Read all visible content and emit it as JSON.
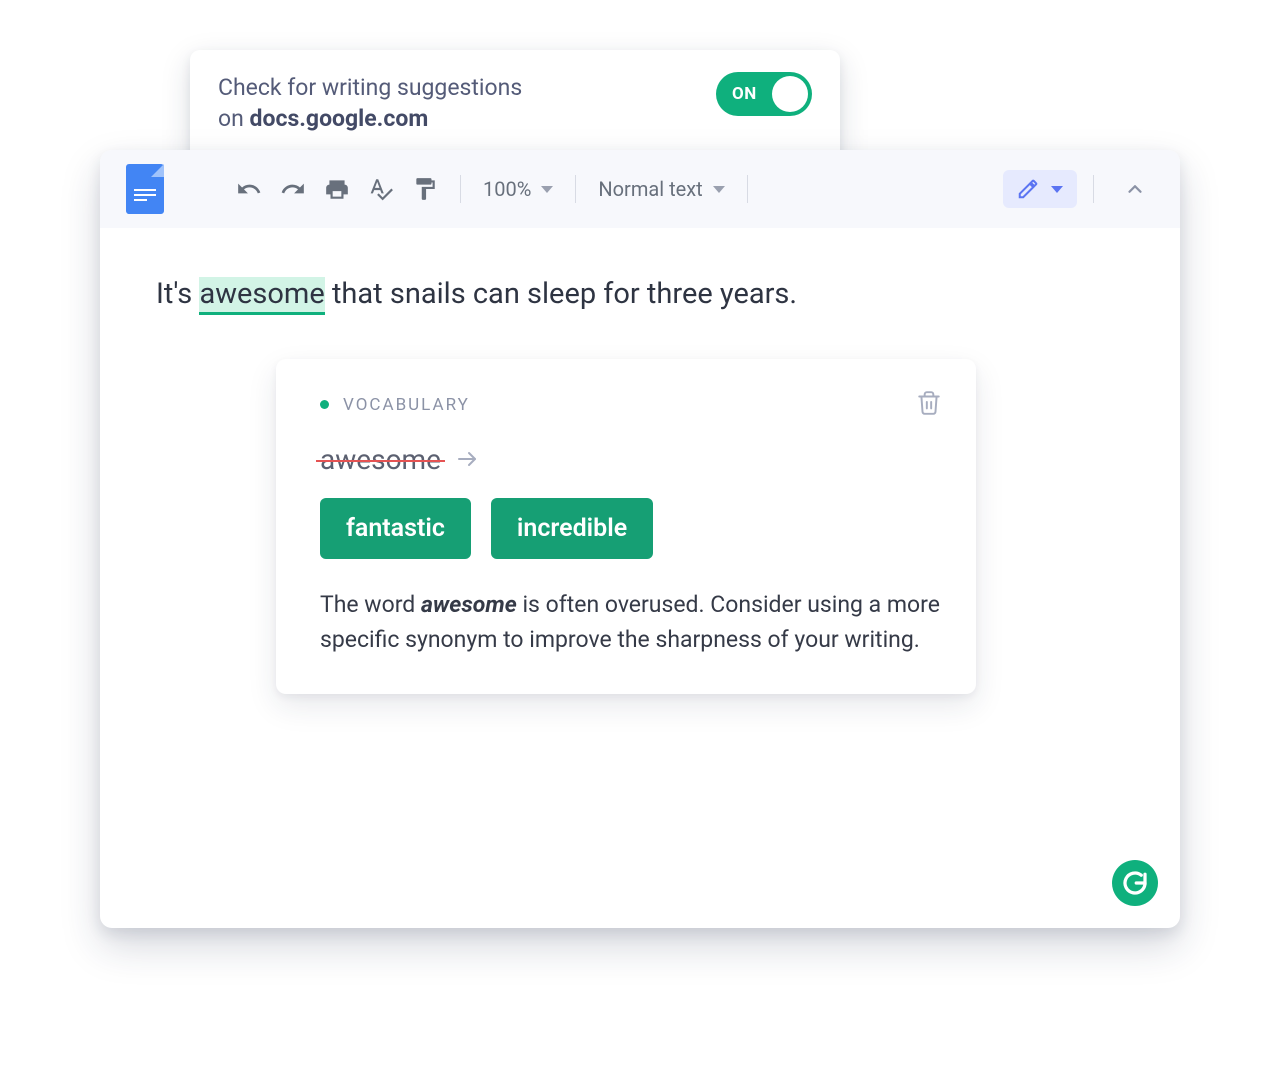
{
  "header": {
    "line1": "Check for writing suggestions",
    "line2_prefix": "on ",
    "domain": "docs.google.com",
    "toggle_label": "ON"
  },
  "toolbar": {
    "zoom": "100%",
    "style": "Normal text"
  },
  "document": {
    "pre": "It's ",
    "highlight": "awesome",
    "post": " that snails can sleep for three years."
  },
  "card": {
    "tag": "VOCABULARY",
    "original_word": "awesome",
    "suggestions": [
      "fantastic",
      "incredible"
    ],
    "desc_pre": "The word ",
    "desc_em": "awesome",
    "desc_post": " is often overused. Consider using a more specific synonym to improve the sharpness of your writing."
  }
}
